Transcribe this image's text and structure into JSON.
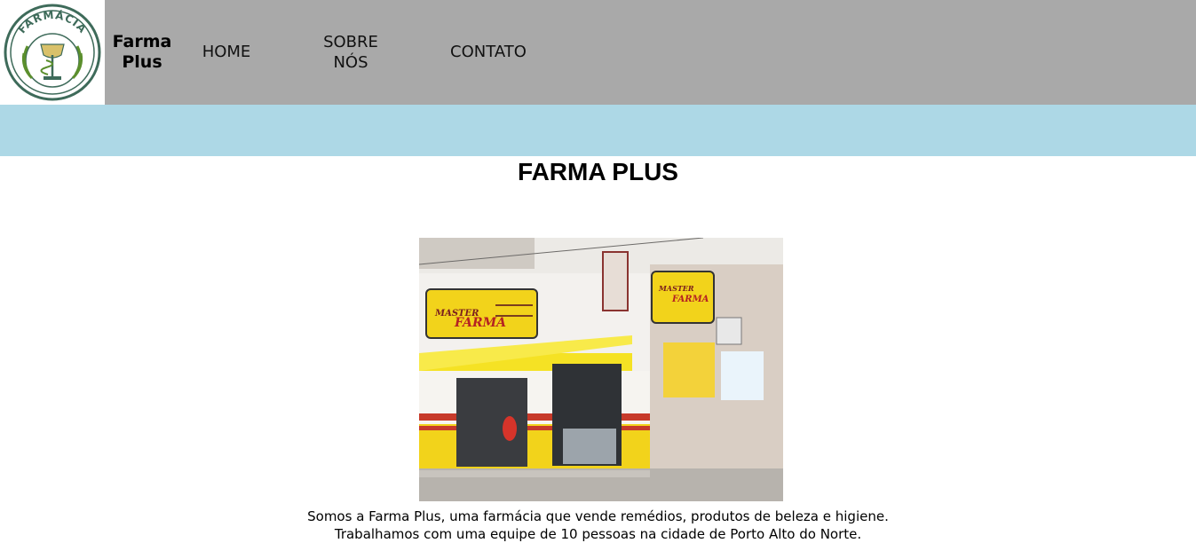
{
  "logo": {
    "text": "FARMÁCIA"
  },
  "header": {
    "brand": "Farma\nPlus"
  },
  "nav": {
    "home": "HOME",
    "sobre": "SOBRE\nNÓS",
    "contato": "CONTATO"
  },
  "main": {
    "title": "FARMA PLUS",
    "paragraph1": "Somos a Farma Plus, uma farmácia que vende remédios, produtos de beleza e higiene.",
    "paragraph2": "Trabalhamos com uma equipe de 10 pessoas na cidade de Porto Alto do Norte."
  },
  "photo_sign": {
    "brand_top": "MASTER",
    "brand_main": "FARMA"
  },
  "colors": {
    "header_bg": "#a9a9a9",
    "band_bg": "#add8e6",
    "logo_green": "#3e6b5a",
    "storefront_yellow": "#f2d31b"
  }
}
